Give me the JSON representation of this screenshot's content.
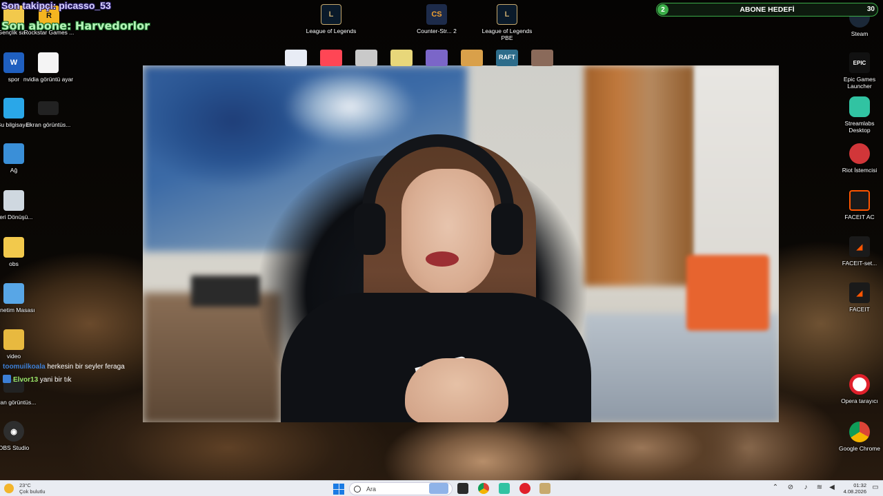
{
  "overlay": {
    "last_follower": "Son takipçi: picasso_53",
    "last_subscriber": "Son abone: Harvedorlor",
    "goal": {
      "title": "ABONE HEDEFİ",
      "current": "2",
      "target": "30"
    }
  },
  "chat": [
    {
      "user": "toomuilkoala",
      "message": "herkesin bir seyler feraga"
    },
    {
      "user": "Elvor13",
      "message": "yani bir tık"
    }
  ],
  "desktop_left": [
    {
      "label": "Gençlik sa...",
      "icon": "folder-icon"
    },
    {
      "label": "Rockstar Games ...",
      "icon": "rockstar-icon"
    },
    {
      "label": "spor",
      "icon": "word-icon"
    },
    {
      "label": "nvidia görüntü ayar",
      "icon": "document-icon"
    },
    {
      "label": "Bu bilgisayar",
      "icon": "computer-icon"
    },
    {
      "label": "Ekran görüntüs...",
      "icon": "screenshot-icon"
    },
    {
      "label": "Ağ",
      "icon": "network-icon"
    },
    {
      "label": "Geri Dönüşü...",
      "icon": "recycle-bin-icon"
    },
    {
      "label": "obs",
      "icon": "folder-icon"
    },
    {
      "label": "Denetim Masası",
      "icon": "control-panel-icon"
    },
    {
      "label": "video",
      "icon": "folder-icon"
    },
    {
      "label": "Ekran görüntüs...",
      "icon": "screenshot-icon"
    },
    {
      "label": "OBS Studio",
      "icon": "obs-icon"
    }
  ],
  "desktop_top": [
    {
      "label": "League of Legends",
      "icon": "league-of-legends-icon"
    },
    {
      "label": "Counter-Str... 2",
      "icon": "counter-strike-icon"
    },
    {
      "label": "League of Legends PBE",
      "icon": "league-of-legends-pbe-icon"
    }
  ],
  "desktop_top_row2": [
    {
      "icon": "plane-icon",
      "color": "#e8ecf5"
    },
    {
      "icon": "valorant-icon",
      "color": "#ff4655"
    },
    {
      "icon": "game-character-icon",
      "color": "#c9c9c9"
    },
    {
      "icon": "game-map-icon",
      "color": "#e8d77a"
    },
    {
      "icon": "mountain-game-icon",
      "color": "#7b66c8"
    },
    {
      "icon": "pixel-game-icon",
      "color": "#d9a04a"
    },
    {
      "icon": "raft-icon",
      "color": "#2d6c8a"
    },
    {
      "icon": "pc-game-icon",
      "color": "#8a6a5a"
    }
  ],
  "desktop_right": [
    {
      "label": "Steam",
      "icon": "steam-icon"
    },
    {
      "label": "Epic Games Launcher",
      "icon": "epic-games-icon"
    },
    {
      "label": "Streamlabs Desktop",
      "icon": "streamlabs-icon"
    },
    {
      "label": "Riot İstemcisi",
      "icon": "riot-client-icon"
    },
    {
      "label": "FACEIT AC",
      "icon": "faceit-ac-icon"
    },
    {
      "label": "FACEIT-set...",
      "icon": "faceit-setup-icon"
    },
    {
      "label": "FACEIT",
      "icon": "faceit-icon"
    },
    {
      "label": "Opera tarayıcı",
      "icon": "opera-icon"
    },
    {
      "label": "Google Chrome",
      "icon": "chrome-icon"
    }
  ],
  "icon_glyphs": {
    "top_lol": "L",
    "top_cs": "CS",
    "top_pbe": "L",
    "left_word": "W",
    "left_obs": "◉",
    "right_epic": "EPIC",
    "right_raft": "RAFT"
  },
  "taskbar": {
    "weather_temp": "23°C",
    "weather_desc": "Çok bulutlu",
    "search_placeholder": "Ara",
    "time": "01:32",
    "date": "4.08.2026",
    "apps": [
      {
        "icon": "task-view-icon",
        "color": "#8fb3e8"
      },
      {
        "icon": "file-explorer-icon",
        "color": "#2b2b2b"
      },
      {
        "icon": "chrome-icon",
        "color": "#db4437"
      },
      {
        "icon": "streamlabs-icon",
        "color": "#31c3a2"
      },
      {
        "icon": "opera-icon",
        "color": "#e0202b"
      },
      {
        "icon": "league-client-icon",
        "color": "#c8aa6e"
      }
    ]
  },
  "colors": {
    "goal_green": "#3cae49",
    "follower_text": "#d8d2ff",
    "subscriber_text": "#b5f3b8"
  }
}
